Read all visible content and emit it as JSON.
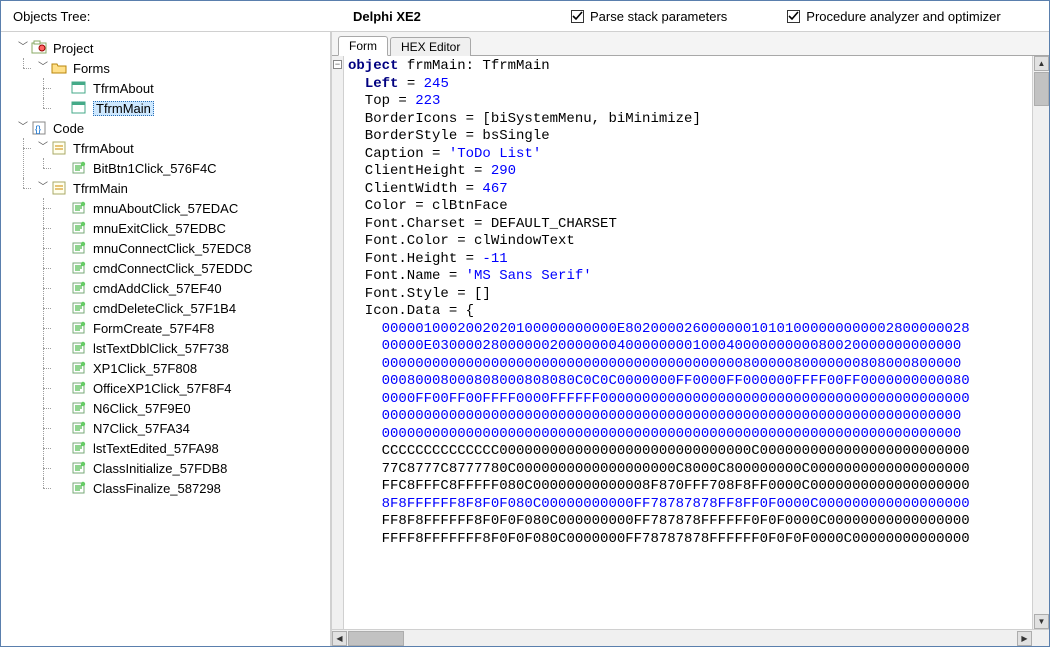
{
  "topbar": {
    "title": "Objects Tree:",
    "brand": "Delphi XE2",
    "check1": "Parse stack parameters",
    "check2": "Procedure analyzer and optimizer"
  },
  "tree": {
    "project": "Project",
    "forms": "Forms",
    "form_about": "TfrmAbout",
    "form_main": "TfrmMain",
    "code": "Code",
    "code_about": "TfrmAbout",
    "code_about_items": [
      "BitBtn1Click_576F4C"
    ],
    "code_main": "TfrmMain",
    "code_main_items": [
      "mnuAboutClick_57EDAC",
      "mnuExitClick_57EDBC",
      "mnuConnectClick_57EDC8",
      "cmdConnectClick_57EDDC",
      "cmdAddClick_57EF40",
      "cmdDeleteClick_57F1B4",
      "FormCreate_57F4F8",
      "lstTextDblClick_57F738",
      "XP1Click_57F808",
      "OfficeXP1Click_57F8F4",
      "N6Click_57F9E0",
      "N7Click_57FA34",
      "lstTextEdited_57FA98",
      "ClassInitialize_57FDB8",
      "ClassFinalize_587298"
    ]
  },
  "tabs": {
    "form": "Form",
    "hex": "HEX Editor"
  },
  "code_lines": [
    {
      "t": "objdecl",
      "kw": "object",
      "n1": "frmMain",
      "n2": "TfrmMain"
    },
    {
      "t": "propnum",
      "name": "Left",
      "bold": true,
      "value": "245"
    },
    {
      "t": "propnum",
      "name": "Top",
      "value": "223"
    },
    {
      "t": "proptxt",
      "name": "BorderIcons",
      "value": "= [biSystemMenu, biMinimize]"
    },
    {
      "t": "proptxt",
      "name": "BorderStyle",
      "value": "= bsSingle"
    },
    {
      "t": "propstr",
      "name": "Caption",
      "value": "'ToDo List'"
    },
    {
      "t": "propnum",
      "name": "ClientHeight",
      "value": "290"
    },
    {
      "t": "propnum",
      "name": "ClientWidth",
      "value": "467"
    },
    {
      "t": "proptxt",
      "name": "Color",
      "value": "= clBtnFace"
    },
    {
      "t": "proptxt",
      "name": "Font.Charset",
      "value": "= DEFAULT_CHARSET"
    },
    {
      "t": "proptxt",
      "name": "Font.Color",
      "value": "= clWindowText"
    },
    {
      "t": "propnum",
      "name": "Font.Height",
      "value": "-11"
    },
    {
      "t": "propstr",
      "name": "Font.Name",
      "value": "'MS Sans Serif'"
    },
    {
      "t": "proptxt",
      "name": "Font.Style",
      "value": "= []"
    },
    {
      "t": "proptxt",
      "name": "Icon.Data",
      "value": "= {"
    },
    {
      "t": "hex",
      "v": "0000010002002020100000000000E80200002600000010101000000000002800000028"
    },
    {
      "t": "hex",
      "v": "00000E030000280000002000000040000000010004000000000080020000000000000"
    },
    {
      "t": "hex",
      "v": "000000000000000000000000000000000000000000080000080000000808000800000"
    },
    {
      "t": "hex",
      "v": "00080008000808000808080C0C0C0000000FF0000FF000000FFFF00FF0000000000080"
    },
    {
      "t": "hex",
      "v": "0000FF00FF00FFFF0000FFFFFF00000000000000000000000000000000000000000000"
    },
    {
      "t": "hex",
      "v": "000000000000000000000000000000000000000000000000000000000000000000000"
    },
    {
      "t": "hex",
      "v": "000000000000000000000000000000000000000000000000000000000000000000000"
    },
    {
      "t": "plain",
      "v": "CCCCCCCCCCCCCC000000000000000000000000000000C0000000000000000000000000"
    },
    {
      "t": "plain",
      "v": "77C8777C8777780C0000000000000000000C8000C800000000C0000000000000000000"
    },
    {
      "t": "plain",
      "v": "FFC8FFFC8FFFFF080C00000000000008F870FFF708F8FF0000C0000000000000000000"
    },
    {
      "t": "hex",
      "v": "8F8FFFFFF8F8F0F080C00000000000FF78787878FF8FF0F0000C000000000000000000"
    },
    {
      "t": "plain",
      "v": "FF8F8FFFFFF8F0F0F080C000000000FF787878FFFFFF0F0F0000C00000000000000000"
    },
    {
      "t": "plain",
      "v": "FFFF8FFFFFFF8F0F0F080C0000000FF78787878FFFFFF0F0F0F0000C00000000000000"
    }
  ]
}
